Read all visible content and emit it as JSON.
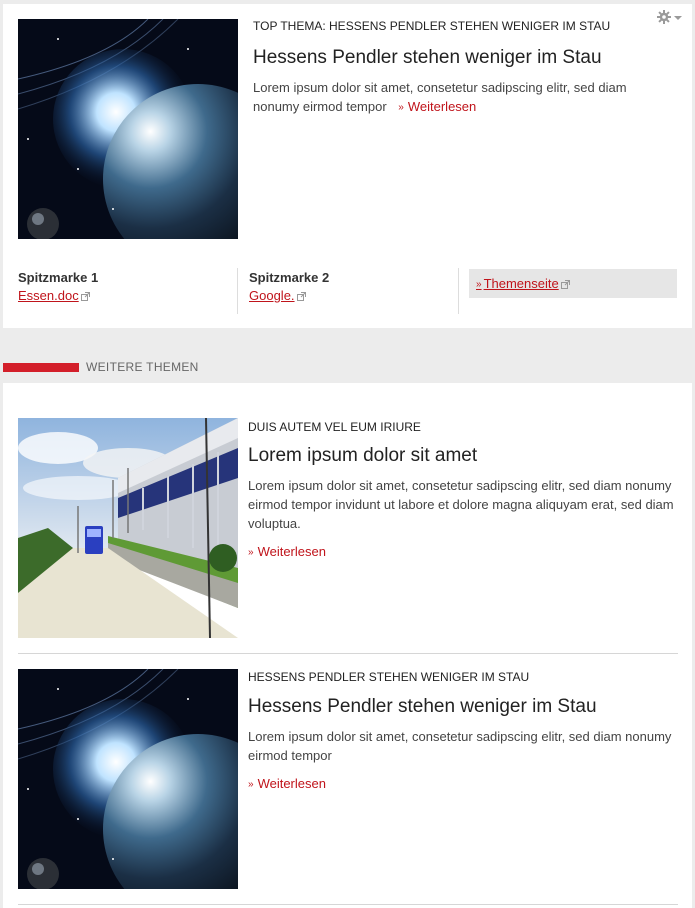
{
  "top_story": {
    "kicker": "TOP THEMA: HESSENS PENDLER STEHEN WENIGER IM STAU",
    "headline": "Hessens Pendler stehen weniger im Stau",
    "teaser": "Lorem ipsum dolor sit amet, consetetur sadipscing elitr, sed diam nonumy eirmod tempor",
    "more_label": "Weiterlesen",
    "image": "planet-space-image"
  },
  "spitzmarken": [
    {
      "label": "Spitzmarke 1",
      "link": "Essen.doc"
    },
    {
      "label": "Spitzmarke 2",
      "link": "Google."
    }
  ],
  "themenseite_label": "Themenseite",
  "section": {
    "title": "WEITERE THEMEN"
  },
  "articles": [
    {
      "kicker": "DUIS AUTEM VEL EUM IRIURE",
      "headline": "Lorem ipsum dolor sit amet",
      "teaser": "Lorem ipsum dolor sit amet, consetetur sadipscing elitr, sed diam nonumy eirmod tempor invidunt ut labore et dolore magna aliquyam erat, sed diam voluptua.",
      "more_label": "Weiterlesen",
      "image": "highway-road-image"
    },
    {
      "kicker": "HESSENS PENDLER STEHEN WENIGER IM STAU",
      "headline": "Hessens Pendler stehen weniger im Stau",
      "teaser": "Lorem ipsum dolor sit amet, consetetur sadipscing elitr, sed diam nonumy eirmod tempor",
      "more_label": "Weiterlesen",
      "image": "planet-space-image"
    }
  ],
  "colors": {
    "accent": "#c0141b",
    "section_bar": "#d31f2a",
    "background": "#ececec"
  },
  "icons": {
    "settings": "gear-icon",
    "external": "external-link-icon",
    "chevron": "double-chevron-icon"
  }
}
